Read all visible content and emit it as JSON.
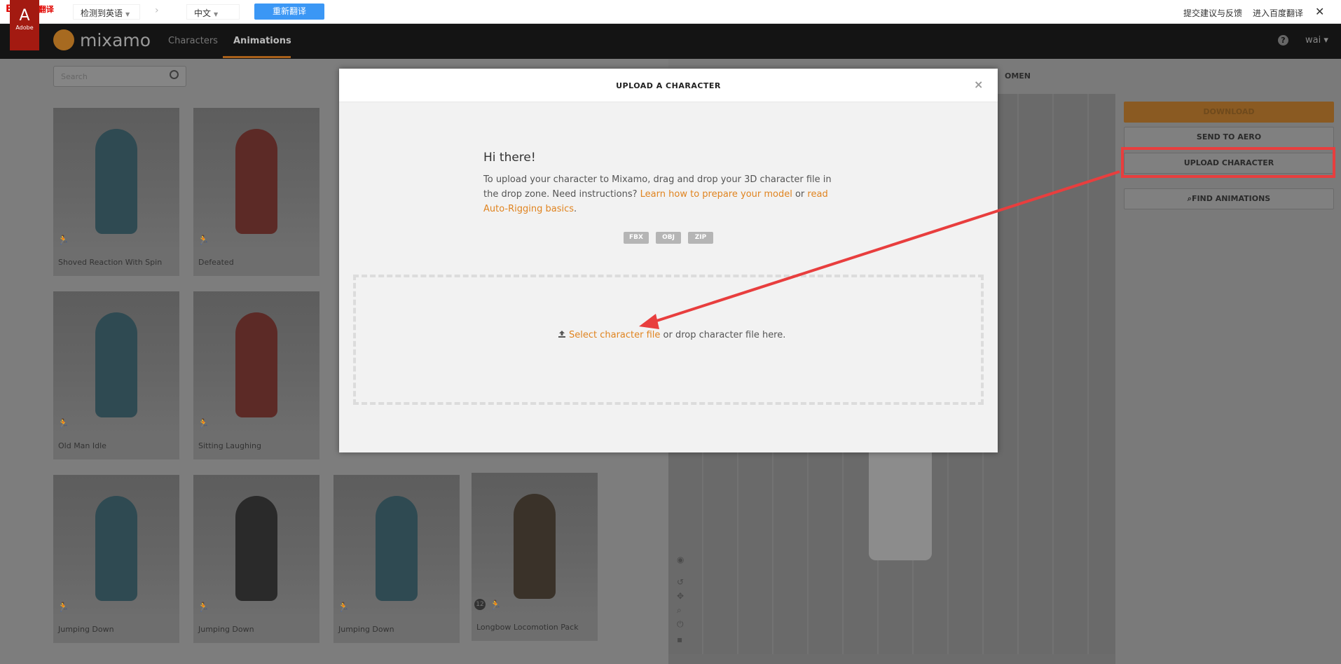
{
  "baidu": {
    "logo_bai": "Bai",
    "logo_du": "du",
    "logo_fy": "翻译",
    "source_lang": "检测到英语",
    "target_lang": "中文",
    "retranslate": "重新翻译",
    "feedback": "提交建议与反馈",
    "enter": "进入百度翻译",
    "close": "✕"
  },
  "header": {
    "adobe": "Adobe",
    "brand": "mixamo",
    "nav": [
      "Characters",
      "Animations"
    ],
    "help": "?",
    "user": "wai"
  },
  "search": {
    "placeholder": "Search"
  },
  "cards": [
    {
      "label": "Shoved Reaction With Spin",
      "tone": "#2f4a52"
    },
    {
      "label": "Defeated",
      "tone": "#5c2a26"
    },
    {
      "label": "Old Man Idle",
      "tone": "#2f4a52"
    },
    {
      "label": "Sitting Laughing",
      "tone": "#5c2a26"
    },
    {
      "label": "Jumping Down",
      "tone": "#2f4a52"
    },
    {
      "label": "Jumping Down",
      "tone": "#2a2a2a"
    },
    {
      "label": "Jumping Down",
      "tone": "#2f4a52"
    },
    {
      "label": "Longbow Locomotion Pack",
      "tone": "#3a3229",
      "badge": "12"
    }
  ],
  "viewport": {
    "women": "OMEN"
  },
  "sidebar": {
    "download": "DOWNLOAD",
    "send": "SEND TO AERO",
    "upload": "UPLOAD CHARACTER",
    "find": "FIND ANIMATIONS"
  },
  "modal": {
    "title": "UPLOAD A CHARACTER",
    "close": "×",
    "greeting": "Hi there!",
    "text1": "To upload your character to Mixamo, drag and drop your 3D character file in the drop zone. Need instructions? ",
    "link1": "Learn how to prepare your model",
    "text2": " or ",
    "link2": "read Auto-Rigging basics",
    "text3": ".",
    "filetypes": [
      "FBX",
      "OBJ",
      "ZIP"
    ],
    "select_link": "Select character file",
    "drop_text": " or drop character file here."
  },
  "colors": {
    "accent": "#e08420",
    "highlight": "#e83e3e"
  }
}
